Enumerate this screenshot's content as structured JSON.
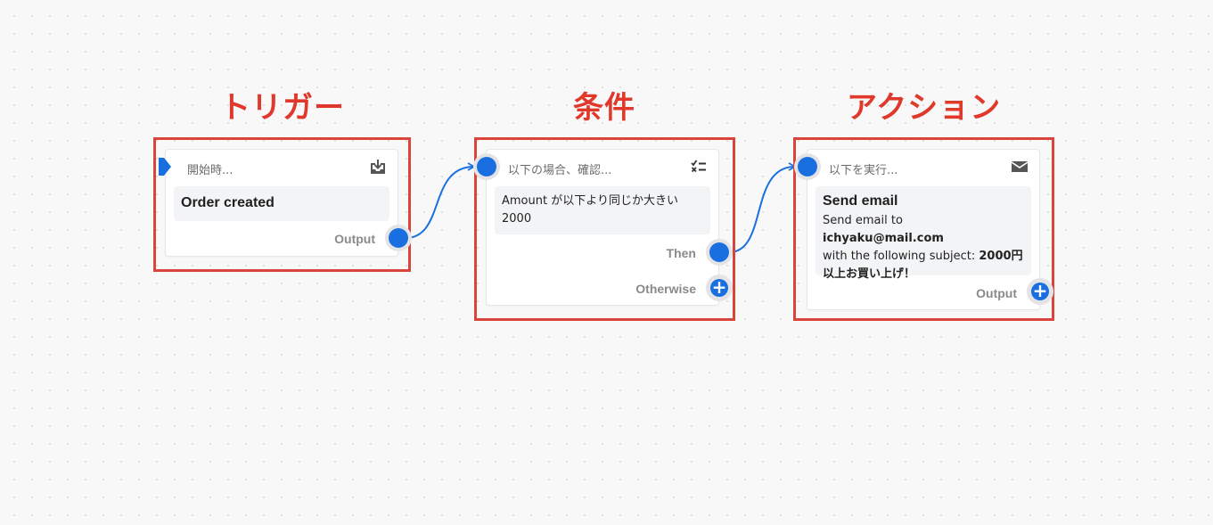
{
  "sections": {
    "trigger": "トリガー",
    "condition": "条件",
    "action": "アクション"
  },
  "accent_colors": {
    "frame": "#d9453a",
    "title": "#e0392b",
    "port": "#1a6fe0"
  },
  "nodes": {
    "trigger": {
      "header": "開始時...",
      "icon": "download-tray-icon",
      "title": "Order created",
      "output_label": "Output"
    },
    "condition": {
      "header": "以下の場合、確認...",
      "icon": "checklist-icon",
      "line1": "Amount が以下より同じか大きい",
      "line2": "2000",
      "then_label": "Then",
      "otherwise_label": "Otherwise"
    },
    "action": {
      "header": "以下を実行...",
      "icon": "envelope-icon",
      "title": "Send email",
      "text_prefix": "Send email to ",
      "email": "ichyaku@mail.com",
      "text_middle": "with the following subject: ",
      "subject_part1": "2000円",
      "subject_part2": "以上お買い上げ！",
      "output_label": "Output"
    }
  },
  "connections": [
    {
      "from": "trigger.output",
      "to": "condition.input"
    },
    {
      "from": "condition.then",
      "to": "action.input"
    }
  ]
}
